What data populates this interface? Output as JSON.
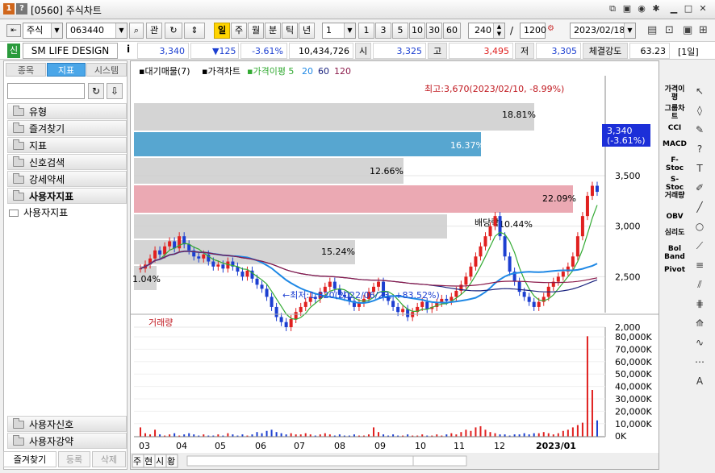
{
  "titlebar": {
    "num_badge": "1",
    "help_badge": "?",
    "title": "[0560] 주식차트"
  },
  "toolbar": {
    "market": "주식",
    "code": "063440",
    "lookup": "관",
    "periods": [
      "일",
      "주",
      "월",
      "분",
      "틱",
      "년"
    ],
    "active_period": "일",
    "interval_value": "1",
    "quick_intervals": [
      "1",
      "3",
      "5",
      "10",
      "30",
      "60"
    ],
    "count": "240",
    "slash": "/",
    "total": "1200",
    "date": "2023/02/18"
  },
  "quote": {
    "badge": "신",
    "name": "SM LIFE DESIGN",
    "info": "i",
    "price": "3,340",
    "change": "▼125",
    "rate": "-3.61%",
    "volume": "10,434,726",
    "open_label": "시",
    "open": "3,325",
    "high_label": "고",
    "high": "3,495",
    "low_label": "저",
    "low": "3,305",
    "strength_label": "체결강도",
    "strength": "63.23",
    "period_label": "[1일]"
  },
  "left": {
    "tabs": [
      "종목",
      "지표",
      "시스템"
    ],
    "active_tab": "지표",
    "folders": [
      "유형",
      "즐겨찾기",
      "지표",
      "신호검색",
      "강세약세",
      "사용자지표"
    ],
    "open_item": "사용자지표",
    "bottom_folders": [
      "사용자신호",
      "사용자강약"
    ],
    "bottom_buttons": [
      "즐겨찾기",
      "등록",
      "삭제"
    ]
  },
  "chart": {
    "legend": [
      "대기매물(7)",
      "가격차트",
      "가격이평 5",
      "20",
      "60",
      "120"
    ],
    "legend_colors": [
      "#000000",
      "#000000",
      "#33aa33",
      "#1e88e5",
      "#1a237e",
      "#8b1a4a"
    ],
    "high_note": "최고:3,670(2023/02/10, -8.99%)",
    "low_note": "←최저:1,820(2022/06/23, +83.52%)",
    "price_ticks": [
      "3,500",
      "3,000",
      "2,500",
      "2,000"
    ],
    "last_price": "3,340",
    "last_rate": "(-3.61%)",
    "profile_labels": [
      "18.81%",
      "16.37%",
      "12.66%",
      "22.09%",
      "10.44%",
      "15.24%",
      "1.04%"
    ],
    "event_label": "배당락",
    "volume_title": "거래량",
    "volume_ticks": [
      "80,000K",
      "70,000K",
      "60,000K",
      "50,000K",
      "40,000K",
      "30,000K",
      "20,000K",
      "10,000K",
      "0K"
    ],
    "months": [
      "03",
      "04",
      "05",
      "06",
      "07",
      "08",
      "09",
      "10",
      "11",
      "12",
      "2023/01"
    ],
    "footer_tabs": [
      "주",
      "현",
      "시",
      "황"
    ]
  },
  "right_tools": [
    "가격이평",
    "그룹차트",
    "CCI",
    "MACD",
    "F-Stoc",
    "S-Stoc",
    "거래량",
    "OBV",
    "심리도",
    "Bol Band",
    "Pivot"
  ],
  "colors": {
    "up": "#e0201f",
    "down": "#1c3fd1",
    "accent": "#2b7dbf",
    "ma5": "#33aa33",
    "ma20": "#1e88e5",
    "ma60": "#1a237e",
    "ma120": "#8b1a4a"
  }
}
